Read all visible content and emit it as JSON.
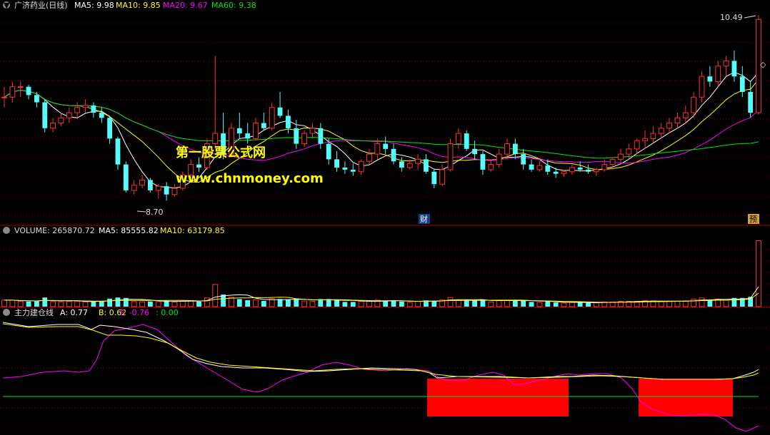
{
  "colors": {
    "up": "#ff3232",
    "down": "#54fcfc",
    "ma5": "#ffffff",
    "ma10": "#ffff00",
    "ma20": "#ff00ff",
    "ma60": "#00e600",
    "grid": "#800000",
    "separator": "#b00000",
    "watermark": "#ffff00",
    "label": "#dddddd"
  },
  "header": {
    "title": "广济药业(日线)",
    "ma5": "MA5: 9.98",
    "ma10": "MA10: 9.85",
    "ma20": "MA20: 9.67",
    "ma60": "MA60: 9.38"
  },
  "watermark": {
    "line1": "第一股票公式网",
    "line2": "www.chnmoney.com"
  },
  "annotations": {
    "high": "10.49",
    "low": "8.70",
    "marker_cai": "财",
    "marker_yu": "预"
  },
  "volume_header": {
    "title": "VOLUME: 265870.72",
    "ma5": "MA5: 85555.82",
    "ma10": "MA10: 63179.85"
  },
  "indicator_header": {
    "title": "主力建仓线",
    "a": "A: 0.77",
    "b": "B: 0.62",
    "f": "F: -0.76",
    "z": ": 0.00"
  },
  "chart_data": [
    {
      "type": "candlestick",
      "panel": "price",
      "ylim": [
        8.6,
        10.5
      ],
      "highlighted_values": {
        "high": 10.49,
        "low": 8.7
      },
      "ohlc": [
        [
          9.7,
          9.8,
          9.6,
          9.7
        ],
        [
          9.7,
          9.85,
          9.65,
          9.8
        ],
        [
          9.8,
          9.85,
          9.7,
          9.8
        ],
        [
          9.8,
          9.82,
          9.68,
          9.72
        ],
        [
          9.72,
          9.75,
          9.6,
          9.65
        ],
        [
          9.65,
          9.68,
          9.36,
          9.4
        ],
        [
          9.4,
          9.5,
          9.36,
          9.45
        ],
        [
          9.45,
          9.55,
          9.42,
          9.5
        ],
        [
          9.5,
          9.6,
          9.45,
          9.55
        ],
        [
          9.55,
          9.65,
          9.5,
          9.6
        ],
        [
          9.6,
          9.68,
          9.55,
          9.62
        ],
        [
          9.62,
          9.65,
          9.5,
          9.55
        ],
        [
          9.55,
          9.6,
          9.45,
          9.5
        ],
        [
          9.5,
          9.52,
          9.25,
          9.3
        ],
        [
          9.3,
          9.32,
          9.0,
          9.05
        ],
        [
          9.05,
          9.08,
          8.78,
          8.8
        ],
        [
          8.8,
          8.9,
          8.76,
          8.85
        ],
        [
          8.85,
          8.95,
          8.82,
          8.9
        ],
        [
          8.9,
          8.92,
          8.78,
          8.8
        ],
        [
          8.8,
          8.86,
          8.72,
          8.84
        ],
        [
          8.84,
          8.88,
          8.7,
          8.76
        ],
        [
          8.76,
          8.86,
          8.74,
          8.82
        ],
        [
          8.82,
          8.98,
          8.8,
          8.95
        ],
        [
          8.95,
          9.1,
          8.92,
          9.05
        ],
        [
          9.05,
          9.12,
          8.98,
          9.02
        ],
        [
          9.02,
          9.3,
          9.0,
          9.25
        ],
        [
          9.25,
          10.1,
          9.2,
          9.35
        ],
        [
          9.35,
          9.55,
          9.1,
          9.15
        ],
        [
          9.15,
          9.45,
          9.12,
          9.4
        ],
        [
          9.4,
          9.55,
          9.3,
          9.35
        ],
        [
          9.35,
          9.45,
          9.25,
          9.3
        ],
        [
          9.3,
          9.5,
          9.28,
          9.45
        ],
        [
          9.45,
          9.55,
          9.38,
          9.4
        ],
        [
          9.4,
          9.65,
          9.38,
          9.6
        ],
        [
          9.6,
          9.75,
          9.5,
          9.52
        ],
        [
          9.52,
          9.58,
          9.35,
          9.4
        ],
        [
          9.4,
          9.48,
          9.2,
          9.25
        ],
        [
          9.25,
          9.38,
          9.22,
          9.35
        ],
        [
          9.35,
          9.45,
          9.3,
          9.4
        ],
        [
          9.4,
          9.45,
          9.2,
          9.25
        ],
        [
          9.25,
          9.3,
          9.05,
          9.1
        ],
        [
          9.1,
          9.18,
          8.98,
          9.02
        ],
        [
          9.02,
          9.08,
          8.96,
          9.0
        ],
        [
          9.0,
          9.06,
          8.94,
          8.98
        ],
        [
          8.98,
          9.1,
          8.95,
          9.08
        ],
        [
          9.08,
          9.2,
          9.05,
          9.15
        ],
        [
          9.15,
          9.3,
          9.1,
          9.25
        ],
        [
          9.25,
          9.32,
          9.15,
          9.2
        ],
        [
          9.2,
          9.25,
          9.05,
          9.08
        ],
        [
          9.08,
          9.12,
          8.98,
          9.02
        ],
        [
          9.02,
          9.1,
          9.0,
          9.06
        ],
        [
          9.06,
          9.15,
          9.0,
          9.1
        ],
        [
          9.1,
          9.15,
          8.96,
          8.98
        ],
        [
          8.98,
          9.0,
          8.82,
          8.86
        ],
        [
          8.86,
          9.05,
          8.84,
          9.0
        ],
        [
          9.0,
          9.3,
          8.98,
          9.25
        ],
        [
          9.25,
          9.4,
          9.2,
          9.35
        ],
        [
          9.35,
          9.38,
          9.18,
          9.2
        ],
        [
          9.2,
          9.28,
          9.1,
          9.15
        ],
        [
          9.15,
          9.18,
          8.95,
          9.0
        ],
        [
          9.0,
          9.1,
          8.98,
          9.05
        ],
        [
          9.05,
          9.2,
          9.02,
          9.15
        ],
        [
          9.15,
          9.3,
          9.1,
          9.25
        ],
        [
          9.25,
          9.3,
          9.1,
          9.15
        ],
        [
          9.15,
          9.2,
          9.0,
          9.05
        ],
        [
          9.05,
          9.1,
          8.98,
          9.0
        ],
        [
          9.0,
          9.08,
          8.98,
          9.04
        ],
        [
          9.04,
          9.1,
          8.95,
          8.98
        ],
        [
          8.98,
          9.02,
          8.92,
          8.96
        ],
        [
          8.96,
          9.0,
          8.93,
          8.98
        ],
        [
          8.98,
          9.05,
          8.95,
          9.02
        ],
        [
          9.02,
          9.08,
          8.98,
          9.0
        ],
        [
          9.0,
          9.05,
          8.96,
          8.98
        ],
        [
          8.98,
          9.02,
          8.94,
          9.0
        ],
        [
          9.0,
          9.1,
          8.98,
          9.05
        ],
        [
          9.05,
          9.12,
          9.0,
          9.1
        ],
        [
          9.1,
          9.2,
          9.05,
          9.15
        ],
        [
          9.15,
          9.25,
          9.1,
          9.2
        ],
        [
          9.2,
          9.3,
          9.15,
          9.28
        ],
        [
          9.28,
          9.38,
          9.2,
          9.3
        ],
        [
          9.3,
          9.42,
          9.25,
          9.35
        ],
        [
          9.35,
          9.45,
          9.3,
          9.4
        ],
        [
          9.4,
          9.5,
          9.35,
          9.45
        ],
        [
          9.45,
          9.55,
          9.4,
          9.5
        ],
        [
          9.5,
          9.62,
          9.45,
          9.55
        ],
        [
          9.55,
          9.75,
          9.5,
          9.7
        ],
        [
          9.7,
          9.95,
          9.65,
          9.9
        ],
        [
          9.9,
          10.0,
          9.8,
          9.85
        ],
        [
          9.85,
          10.05,
          9.8,
          10.0
        ],
        [
          10.0,
          10.1,
          9.9,
          10.05
        ],
        [
          10.05,
          10.15,
          9.85,
          9.9
        ],
        [
          9.9,
          10.0,
          9.7,
          9.75
        ],
        [
          9.75,
          9.85,
          9.5,
          9.55
        ],
        [
          9.55,
          10.49,
          9.53,
          10.45
        ]
      ]
    },
    {
      "type": "bar",
      "panel": "volume",
      "ylim": [
        0,
        270000
      ]
    },
    {
      "type": "line",
      "panel": "indicator",
      "series": [
        {
          "name": "A"
        },
        {
          "name": "B"
        },
        {
          "name": "F"
        }
      ]
    }
  ]
}
